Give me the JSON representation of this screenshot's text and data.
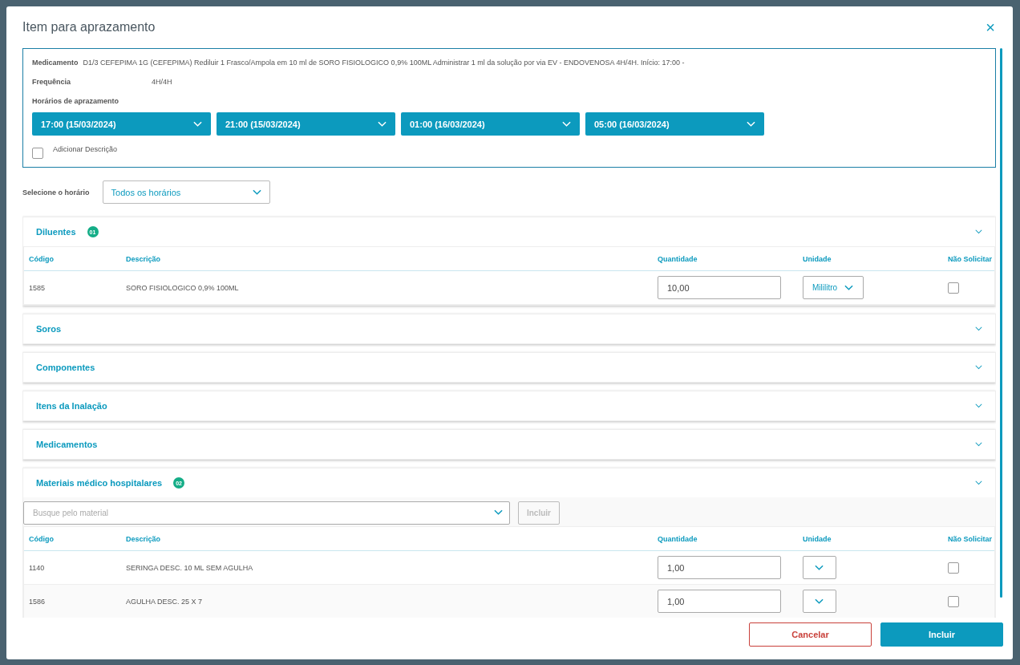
{
  "dialog": {
    "title": "Item para aprazamento",
    "close": "×"
  },
  "info": {
    "medication_label": "Medicamento",
    "medication": "D1/3 CEFEPIMA 1G (CEFEPIMA) Rediluir 1 Frasco/Ampola em 10 ml de SORO FISIOLOGICO 0,9% 100ML Administrar 1 ml da solução por via EV - ENDOVENOSA 4H/4H. Início: 17:00 -",
    "frequency_label": "Frequência",
    "frequency": "4H/4H",
    "schedule_label": "Horários de aprazamento",
    "schedules": [
      "17:00 (15/03/2024)",
      "21:00 (15/03/2024)",
      "01:00 (16/03/2024)",
      "05:00 (16/03/2024)"
    ],
    "add_description": {
      "label": "Adicionar Descrição",
      "checked": false
    }
  },
  "time_filter": {
    "label": "Selecione o horário",
    "value": "Todos os horários"
  },
  "sections": [
    {
      "title": "Diluentes",
      "badge": "01",
      "expanded": true,
      "columns": [
        "Código",
        "Descrição",
        "Quantidade",
        "Unidade",
        "Não Solicitar"
      ],
      "rows": [
        {
          "code": "1585",
          "description": "SORO FISIOLOGICO 0,9% 100ML",
          "quantity": "10,00",
          "unit": "Mililitro",
          "not_requested": false
        }
      ]
    },
    {
      "title": "Soros",
      "expanded": false
    },
    {
      "title": "Componentes",
      "expanded": false
    },
    {
      "title": "Itens da Inalação",
      "expanded": false
    },
    {
      "title": "Medicamentos",
      "expanded": false
    },
    {
      "title": "Materiais médico hospitalares",
      "badge": "02",
      "expanded": true,
      "search": {
        "placeholder": "Busque pelo material",
        "button": "Incluir",
        "disabled": true
      },
      "columns": [
        "Código",
        "Descrição",
        "Quantidade",
        "Unidade",
        "Não Solicitar"
      ],
      "rows": [
        {
          "code": "1140",
          "description": "SERINGA DESC. 10 ML SEM AGULHA",
          "quantity": "1,00",
          "not_requested": false
        },
        {
          "code": "1586",
          "description": "AGULHA DESC. 25 X 7",
          "quantity": "1,00",
          "not_requested": false
        }
      ]
    }
  ],
  "buttons": [
    {
      "label": "Cancelar",
      "kind": "secondary"
    },
    {
      "label": "Incluir",
      "kind": "primary"
    }
  ]
}
